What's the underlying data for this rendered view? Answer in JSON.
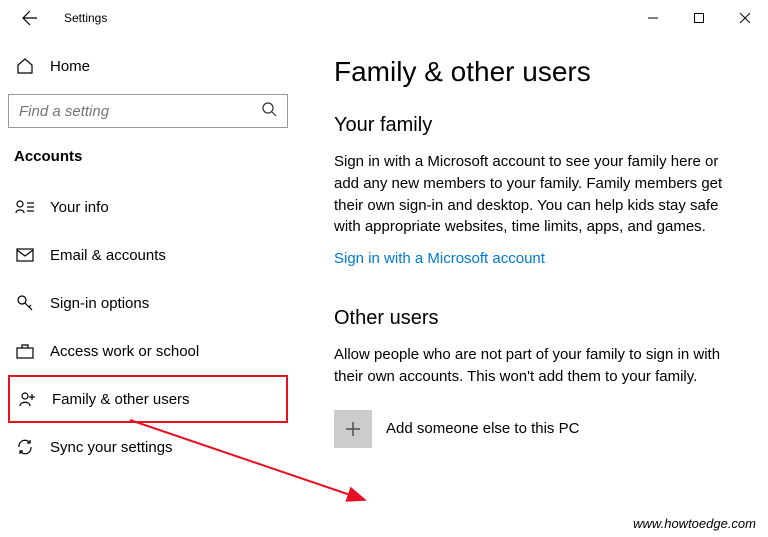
{
  "window": {
    "title": "Settings"
  },
  "sidebar": {
    "home_label": "Home",
    "search_placeholder": "Find a setting",
    "category": "Accounts",
    "items": [
      {
        "label": "Your info"
      },
      {
        "label": "Email & accounts"
      },
      {
        "label": "Sign-in options"
      },
      {
        "label": "Access work or school"
      },
      {
        "label": "Family & other users"
      },
      {
        "label": "Sync your settings"
      }
    ]
  },
  "main": {
    "page_title": "Family & other users",
    "family": {
      "title": "Your family",
      "text": "Sign in with a Microsoft account to see your family here or add any new members to your family. Family members get their own sign-in and desktop. You can help kids stay safe with appropriate websites, time limits, apps, and games.",
      "link": "Sign in with a Microsoft account"
    },
    "other": {
      "title": "Other users",
      "text": "Allow people who are not part of your family to sign in with their own accounts. This won't add them to your family.",
      "add_label": "Add someone else to this PC"
    }
  },
  "watermark": "www.howtoedge.com"
}
